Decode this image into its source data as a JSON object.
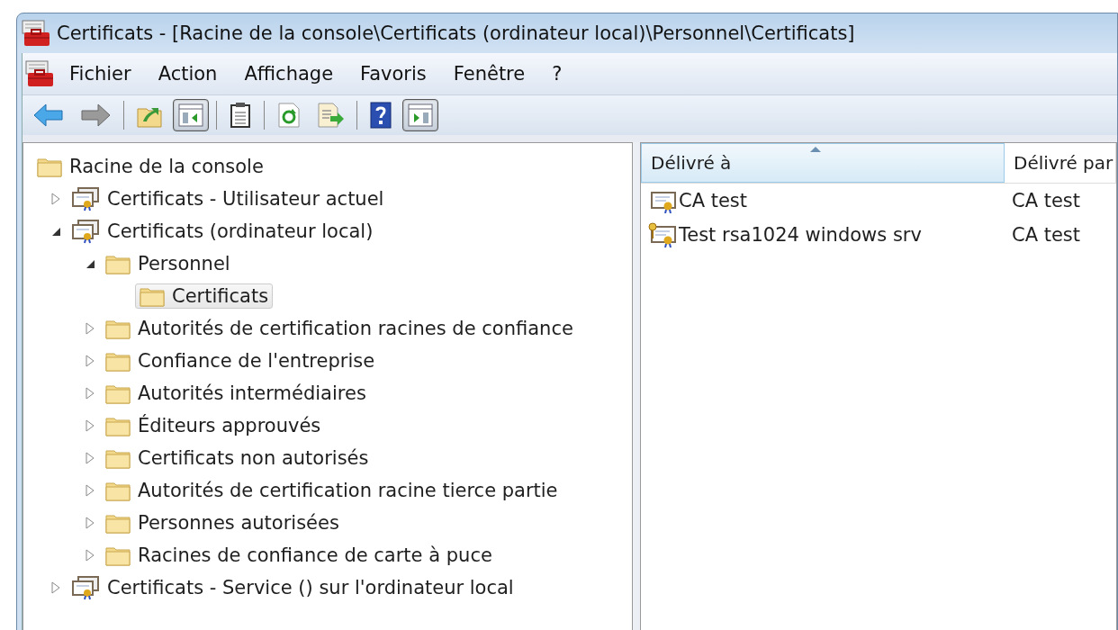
{
  "window": {
    "title": "Certificats - [Racine de la console\\Certificats (ordinateur local)\\Personnel\\Certificats]"
  },
  "menu": [
    "Fichier",
    "Action",
    "Affichage",
    "Favoris",
    "Fenêtre",
    "?"
  ],
  "toolbar": [
    {
      "kind": "back",
      "pressed": false
    },
    {
      "kind": "forward",
      "pressed": false
    },
    {
      "kind": "sep"
    },
    {
      "kind": "up",
      "pressed": false
    },
    {
      "kind": "tree",
      "pressed": true
    },
    {
      "kind": "sep"
    },
    {
      "kind": "clipboard",
      "pressed": false
    },
    {
      "kind": "sep"
    },
    {
      "kind": "refresh",
      "pressed": false
    },
    {
      "kind": "export",
      "pressed": false
    },
    {
      "kind": "sep"
    },
    {
      "kind": "help",
      "pressed": false
    },
    {
      "kind": "actions",
      "pressed": true
    }
  ],
  "tree": [
    {
      "label": "Racine de la console",
      "kind": "folder",
      "selected": false,
      "children": [
        {
          "label": "Certificats - Utilisateur actuel",
          "kind": "store",
          "selected": false,
          "expanded": false
        },
        {
          "label": "Certificats (ordinateur local)",
          "kind": "store",
          "selected": false,
          "expanded": true,
          "children": [
            {
              "label": "Personnel",
              "kind": "folder",
              "selected": false,
              "expanded": true,
              "children": [
                {
                  "label": "Certificats",
                  "kind": "folder",
                  "selected": true
                }
              ]
            },
            {
              "label": "Autorités de certification racines de confiance",
              "kind": "folder",
              "selected": false,
              "expanded": false
            },
            {
              "label": "Confiance de l'entreprise",
              "kind": "folder",
              "selected": false,
              "expanded": false
            },
            {
              "label": "Autorités intermédiaires",
              "kind": "folder",
              "selected": false,
              "expanded": false
            },
            {
              "label": "Éditeurs approuvés",
              "kind": "folder",
              "selected": false,
              "expanded": false
            },
            {
              "label": "Certificats non autorisés",
              "kind": "folder",
              "selected": false,
              "expanded": false
            },
            {
              "label": "Autorités de certification racine tierce partie",
              "kind": "folder",
              "selected": false,
              "expanded": false
            },
            {
              "label": "Personnes autorisées",
              "kind": "folder",
              "selected": false,
              "expanded": false
            },
            {
              "label": "Racines de confiance de carte à puce",
              "kind": "folder",
              "selected": false,
              "expanded": false
            }
          ]
        },
        {
          "label": "Certificats - Service () sur l'ordinateur local",
          "kind": "store",
          "selected": false,
          "expanded": false
        }
      ]
    }
  ],
  "list": {
    "columns": [
      {
        "label": "Délivré à",
        "sorted": true
      },
      {
        "label": "Délivré par",
        "sorted": false
      }
    ],
    "rows": [
      {
        "kind": "certificate",
        "cells": [
          "CA test",
          "CA test"
        ]
      },
      {
        "kind": "certificate-key",
        "cells": [
          "Test rsa1024 windows srv",
          "CA test"
        ]
      }
    ]
  }
}
